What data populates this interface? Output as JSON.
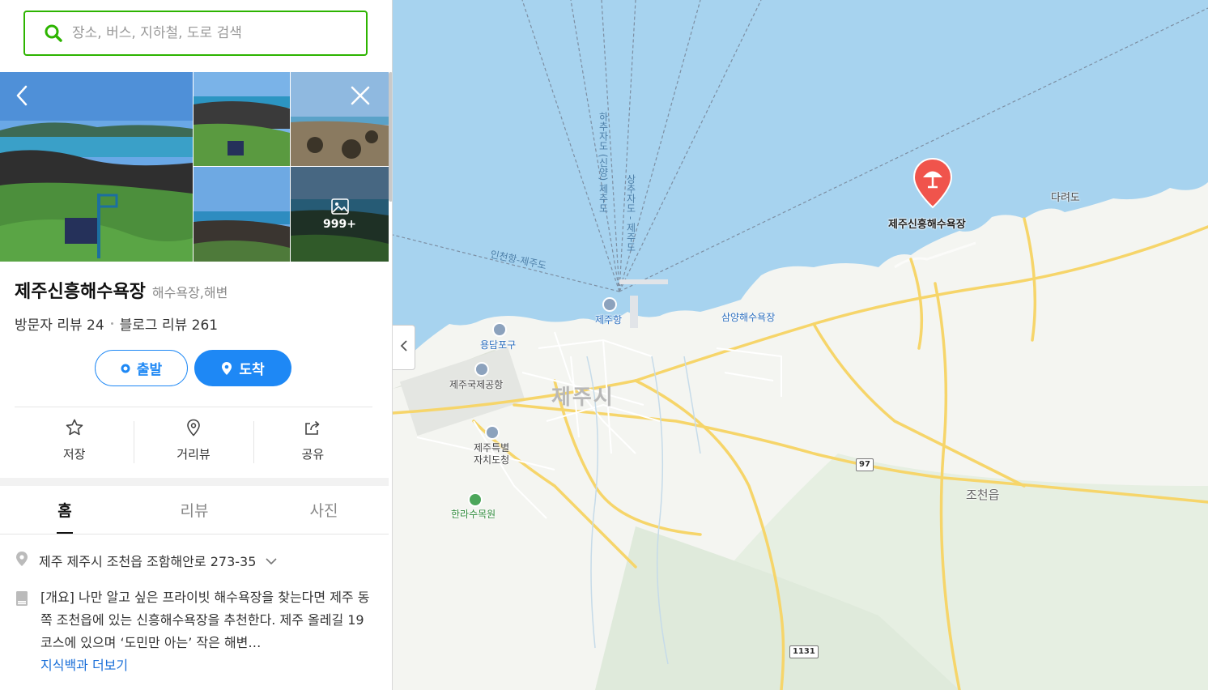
{
  "search": {
    "placeholder": "장소, 버스, 지하철, 도로 검색"
  },
  "photos": {
    "more_count": "999+"
  },
  "place": {
    "name": "제주신흥해수욕장",
    "category": "해수욕장,해변",
    "visitor_reviews": "방문자 리뷰 24",
    "blog_reviews": "블로그 리뷰 261"
  },
  "route": {
    "start_label": "출발",
    "arrive_label": "도착"
  },
  "actions": {
    "save": "저장",
    "street_view": "거리뷰",
    "share": "공유"
  },
  "tabs": [
    "홈",
    "리뷰",
    "사진"
  ],
  "info": {
    "address": "제주 제주시 조천읍 조함해안로 273-35",
    "description": "[개요] 나만 알고 싶은 프라이빗 해수욕장을 찾는다면 제주 동쪽 조천읍에 있는 신흥해수욕장을 추천한다. 제주 올레길 19코스에 있으며 ‘도민만 아는’ 작은 해변…",
    "more_link": "지식백과 더보기"
  },
  "map": {
    "labels": {
      "marker": "제주신흥해수욕장",
      "daryeodo": "다려도",
      "jeju_port": "제주항",
      "yongdam": "용담포구",
      "airport": "제주국제공항",
      "jeju_city": "제주시",
      "provincial_office_1": "제주특별",
      "provincial_office_2": "자치도청",
      "arboretum": "한라수목원",
      "samyang": "삼양해수욕장",
      "jocheon": "조천읍",
      "route_1": "인천항-제주도",
      "route_2": "하추자도 (신양) 제주도",
      "route_3": "상추자도 - 제주도",
      "road_97": "97",
      "road_1131": "1131"
    }
  },
  "colors": {
    "search_border": "#2db400",
    "primary_blue": "#1e88f5",
    "marker_red": "#f0544c",
    "sea": "#a7d3ef",
    "land": "#f4f5f1"
  }
}
